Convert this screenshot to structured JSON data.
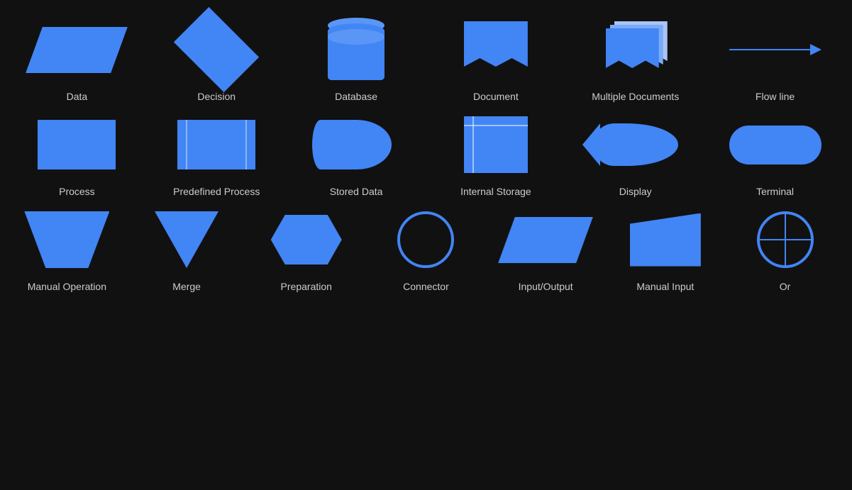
{
  "rows": [
    {
      "shapes": [
        {
          "id": "data",
          "label": "Data"
        },
        {
          "id": "decision",
          "label": "Decision"
        },
        {
          "id": "database",
          "label": "Database"
        },
        {
          "id": "document",
          "label": "Document"
        },
        {
          "id": "multiple-documents",
          "label": "Multiple Documents"
        },
        {
          "id": "flow-line",
          "label": "Flow line"
        }
      ]
    },
    {
      "shapes": [
        {
          "id": "process",
          "label": "Process"
        },
        {
          "id": "predefined-process",
          "label": "Predefined Process"
        },
        {
          "id": "stored-data",
          "label": "Stored Data"
        },
        {
          "id": "internal-storage",
          "label": "Internal Storage"
        },
        {
          "id": "display",
          "label": "Display"
        },
        {
          "id": "terminal",
          "label": "Terminal"
        }
      ]
    },
    {
      "shapes": [
        {
          "id": "manual-operation",
          "label": "Manual Operation"
        },
        {
          "id": "merge",
          "label": "Merge"
        },
        {
          "id": "preparation",
          "label": "Preparation"
        },
        {
          "id": "connector",
          "label": "Connector"
        },
        {
          "id": "input-output",
          "label": "Input/Output"
        },
        {
          "id": "manual-input",
          "label": "Manual Input"
        },
        {
          "id": "or",
          "label": "Or"
        }
      ]
    }
  ]
}
